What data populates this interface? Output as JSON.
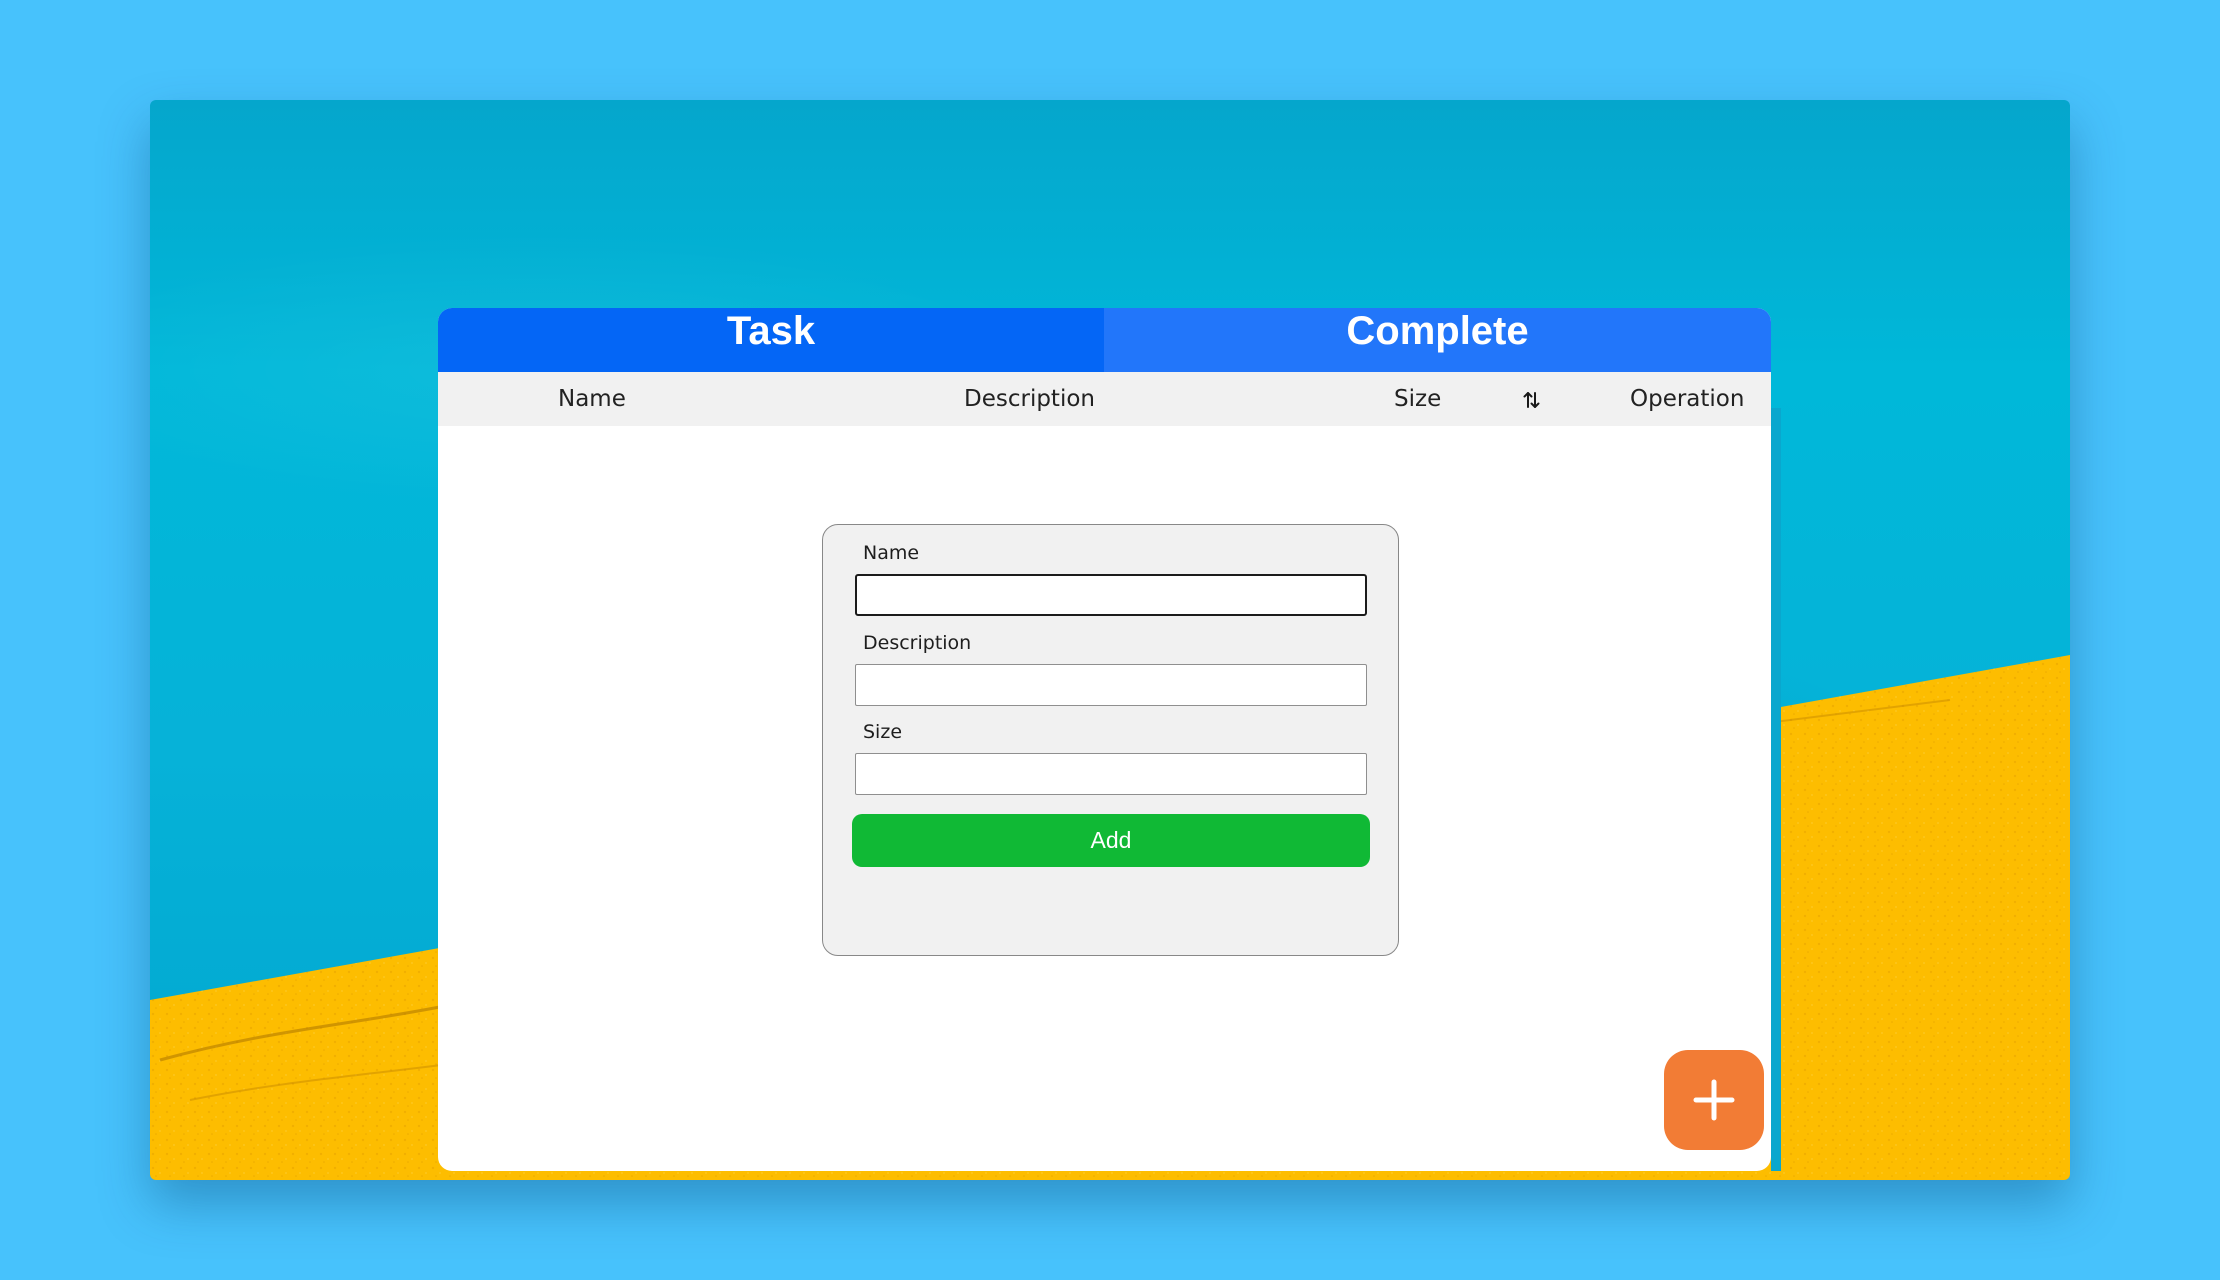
{
  "tabs": [
    {
      "label": "Task"
    },
    {
      "label": "Complete"
    }
  ],
  "table": {
    "columns": [
      "Name",
      "Description",
      "Size",
      "Operation"
    ],
    "sort_icon": "sort-arrows-icon"
  },
  "form": {
    "name_label": "Name",
    "name_value": "",
    "description_label": "Description",
    "description_value": "",
    "size_label": "Size",
    "size_value": "",
    "submit_label": "Add"
  },
  "fab": {
    "icon": "plus-icon"
  },
  "colors": {
    "tab_task": "#0466f6",
    "tab_complete": "#2276fa",
    "add_button": "#10b935",
    "fab": "#f27c35",
    "page_background": "#47c2fc"
  }
}
